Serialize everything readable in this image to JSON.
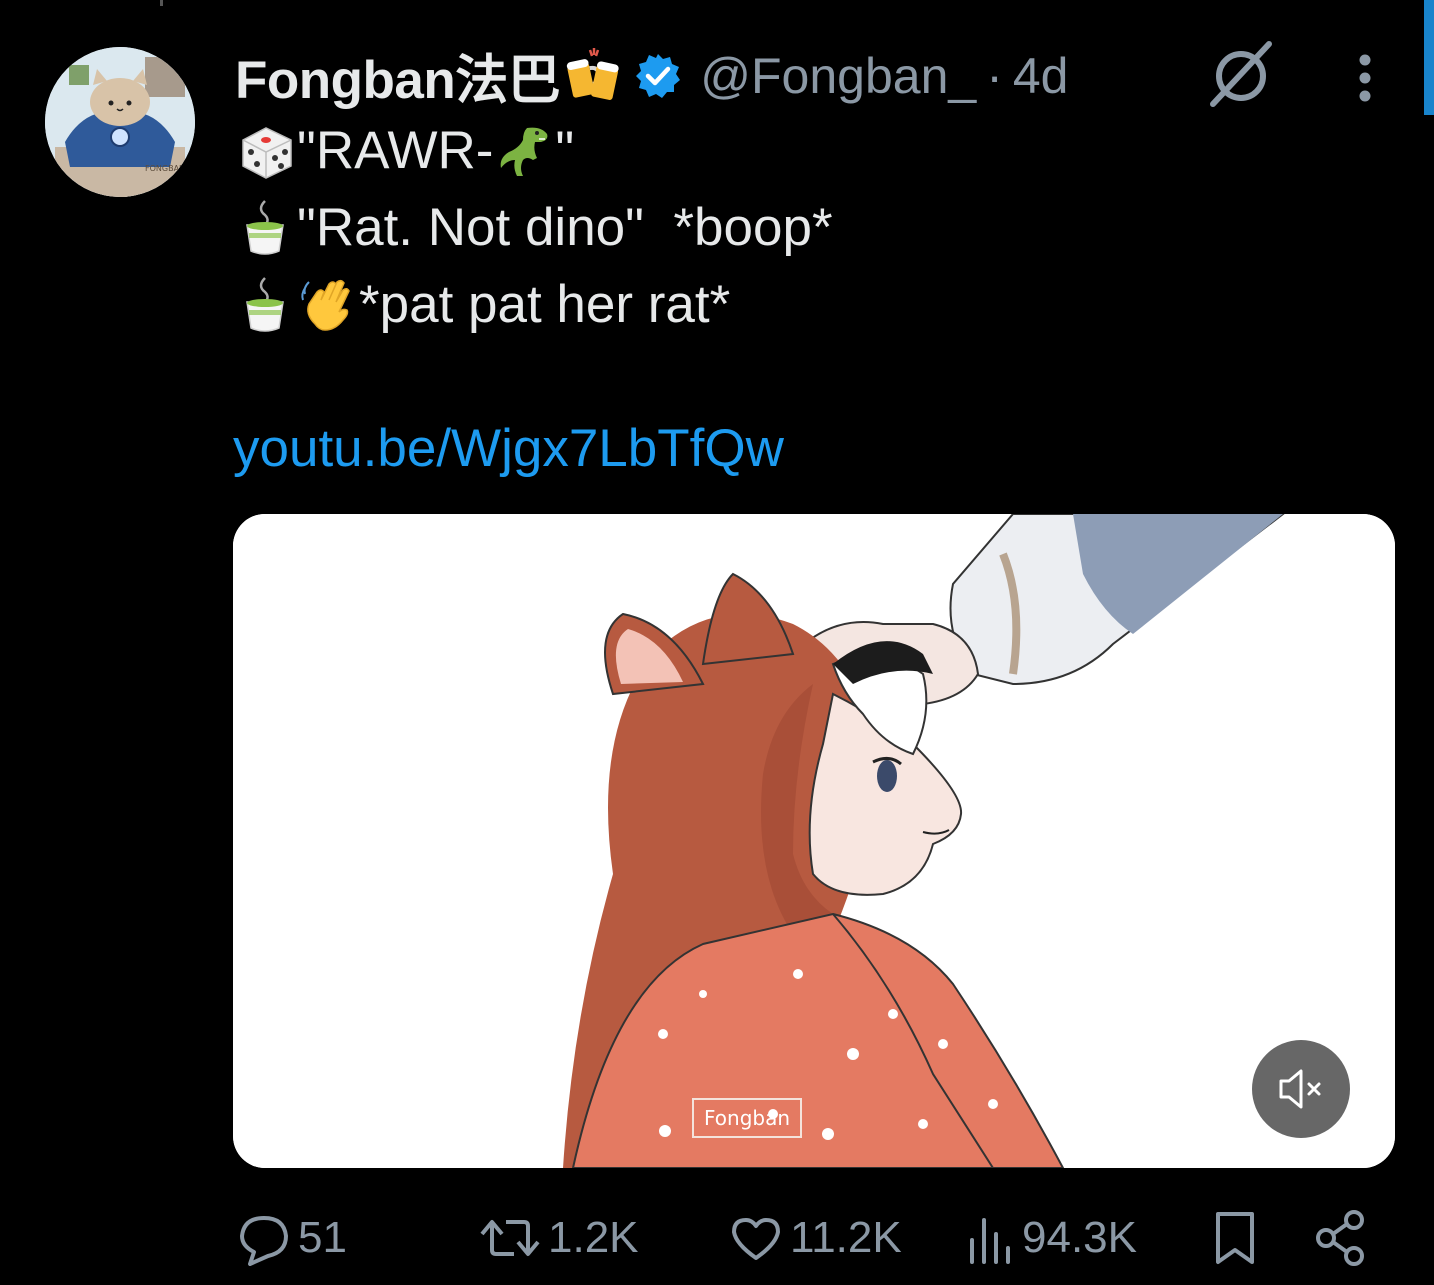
{
  "author": {
    "display_name": "Fongban法巴",
    "handle": "@Fongban_",
    "separator": "·",
    "time_ago": "4d",
    "verified": true,
    "avatar_text": "FONGBAN 法巴"
  },
  "tweet": {
    "lines": [
      {
        "emoji": [
          "game-die-icon"
        ],
        "text": "\"RAWR-",
        "trailing_emoji": "t-rex-icon",
        "trailing_text": "\""
      },
      {
        "emoji": [
          "teacup-icon"
        ],
        "text": "\"Rat. Not dino\"  *boop*"
      },
      {
        "emoji": [
          "teacup-icon",
          "waving-hand-icon"
        ],
        "text": "*pat pat her rat*"
      }
    ],
    "link": "youtu.be/Wjgx7LbTfQw"
  },
  "media": {
    "type": "video",
    "watermark": "Fongban",
    "muted": true
  },
  "actions": {
    "replies": "51",
    "reposts": "1.2K",
    "likes": "11.2K",
    "views": "94.3K"
  },
  "colors": {
    "background": "#000000",
    "text": "#e7e9ea",
    "secondary": "#8b98a5",
    "link": "#1d9bf0",
    "verified": "#1d9bf0"
  }
}
